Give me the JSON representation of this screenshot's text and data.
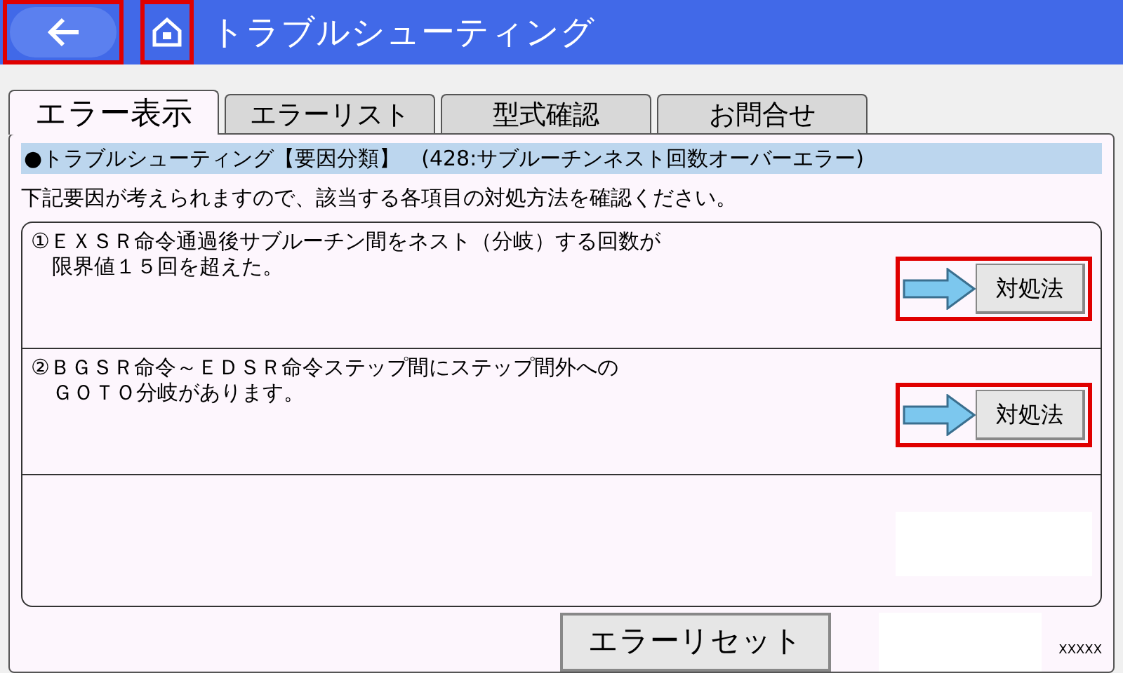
{
  "header": {
    "title": "トラブルシューティング"
  },
  "tabs": [
    {
      "label": "エラー表示",
      "selected": true
    },
    {
      "label": "エラーリスト",
      "selected": false
    },
    {
      "label": "型式確認",
      "selected": false
    },
    {
      "label": "お問合せ",
      "selected": false
    }
  ],
  "section_heading": "●トラブルシューティング【要因分類】　(428:サブルーチンネスト回数オーバーエラー)",
  "instruction": "下記要因が考えられますので、該当する各項目の対処方法を確認ください。",
  "causes": [
    {
      "lines": [
        "①ＥＸＳＲ命令通過後サブルーチン間をネスト（分岐）する回数が",
        "　限界値１５回を超えた。"
      ],
      "button": "対処法"
    },
    {
      "lines": [
        "②ＢＧＳＲ命令～ＥＤＳＲ命令ステップ間にステップ間外への",
        "　ＧＯＴＯ分岐があります。"
      ],
      "button": "対処法"
    }
  ],
  "reset_button": "エラーリセット",
  "footer_code": "XXXXX"
}
